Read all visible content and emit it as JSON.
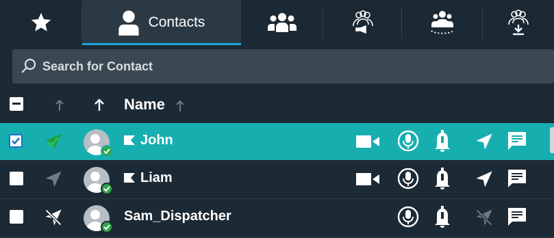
{
  "tabs": [
    {
      "name": "favorites",
      "label": "",
      "icon": "star-icon",
      "active": false
    },
    {
      "name": "contacts",
      "label": "Contacts",
      "icon": "person-icon",
      "active": true
    },
    {
      "name": "groups",
      "label": "",
      "icon": "group-icon",
      "active": false
    },
    {
      "name": "broadcast",
      "label": "",
      "icon": "broadcast-group-icon",
      "active": false
    },
    {
      "name": "dispatch",
      "label": "",
      "icon": "dispatch-group-icon",
      "active": false
    },
    {
      "name": "import",
      "label": "",
      "icon": "import-group-icon",
      "active": false
    }
  ],
  "search": {
    "placeholder": "Search for Contact",
    "value": ""
  },
  "list_header": {
    "name_label": "Name",
    "sort": "ascending"
  },
  "contacts": [
    {
      "name": "John",
      "selected": true,
      "checked": true,
      "location_icon": "location-arrow-icon",
      "has_flag": true,
      "status": "online",
      "actions": [
        "video-call-icon",
        "ptt-mic-icon",
        "alert-bell-icon",
        "location-arrow-icon",
        "message-icon"
      ]
    },
    {
      "name": "Liam",
      "selected": false,
      "checked": false,
      "location_icon": "location-arrow-icon",
      "has_flag": true,
      "status": "online",
      "actions": [
        "video-call-icon",
        "ptt-mic-icon",
        "alert-bell-icon",
        "location-arrow-icon",
        "message-icon"
      ]
    },
    {
      "name": "Sam_Dispatcher",
      "selected": false,
      "checked": false,
      "location_icon": "location-off-icon",
      "has_flag": false,
      "status": "online",
      "actions": [
        "ptt-mic-icon",
        "alert-bell-icon",
        "location-off-icon",
        "message-icon"
      ]
    }
  ],
  "colors": {
    "background": "#1c2a35",
    "selected_row": "#17aeb0",
    "active_tab_underline": "#1aa8d8",
    "online": "#2ea84a"
  }
}
